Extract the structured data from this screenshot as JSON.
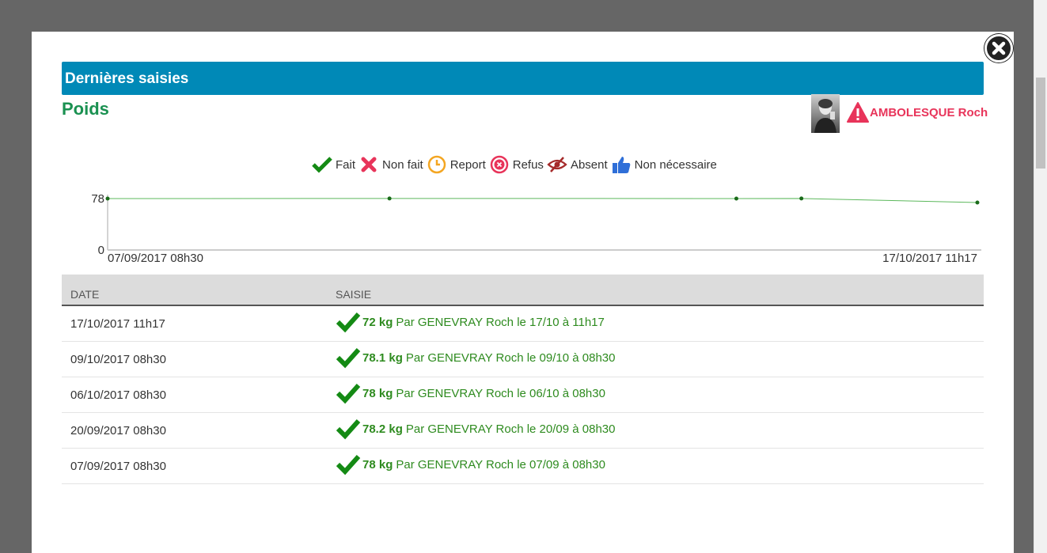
{
  "header": {
    "title": "Dernières saisies"
  },
  "section": {
    "title": "Poids"
  },
  "patient": {
    "name": "AMBOLESQUE Roch",
    "photo_icon": "patient-photo",
    "alert_icon": "warning-icon"
  },
  "legend": [
    {
      "label": "Fait",
      "icon": "check-icon"
    },
    {
      "label": "Non fait",
      "icon": "cross-icon"
    },
    {
      "label": "Report",
      "icon": "clock-icon"
    },
    {
      "label": "Refus",
      "icon": "refusal-icon"
    },
    {
      "label": "Absent",
      "icon": "eye-slash-icon"
    },
    {
      "label": "Non nécessaire",
      "icon": "thumbs-up-icon"
    }
  ],
  "chart_data": {
    "type": "line",
    "x": [
      "07/09/2017 08h30",
      "20/09/2017 08h30",
      "06/10/2017 08h30",
      "09/10/2017 08h30",
      "17/10/2017 11h17"
    ],
    "series": [
      {
        "values": [
          78,
          78.2,
          78,
          78.1,
          72
        ]
      }
    ],
    "yticks": [
      "0",
      "78"
    ],
    "xtick_labels": [
      "07/09/2017 08h30",
      "17/10/2017 11h17"
    ],
    "ylim": [
      0,
      78
    ],
    "line_color": "#5cb85c",
    "point_color": "#1a6b1a"
  },
  "table": {
    "columns": [
      "DATE",
      "SAISIE"
    ],
    "rows": [
      {
        "date": "17/10/2017 11h17",
        "value": "72 kg",
        "detail": "Par GENEVRAY Roch le 17/10 à 11h17"
      },
      {
        "date": "09/10/2017 08h30",
        "value": "78.1 kg",
        "detail": "Par GENEVRAY Roch le 09/10 à 08h30"
      },
      {
        "date": "06/10/2017 08h30",
        "value": "78 kg",
        "detail": "Par GENEVRAY Roch le 06/10 à 08h30"
      },
      {
        "date": "20/09/2017 08h30",
        "value": "78.2 kg",
        "detail": "Par GENEVRAY Roch le 20/09 à 08h30"
      },
      {
        "date": "07/09/2017 08h30",
        "value": "78 kg",
        "detail": "Par GENEVRAY Roch le 07/09 à 08h30"
      }
    ]
  },
  "colors": {
    "header": "#0089b7",
    "title": "#1a9151",
    "patient": "#e8345a",
    "done": "#2e8b1f"
  }
}
